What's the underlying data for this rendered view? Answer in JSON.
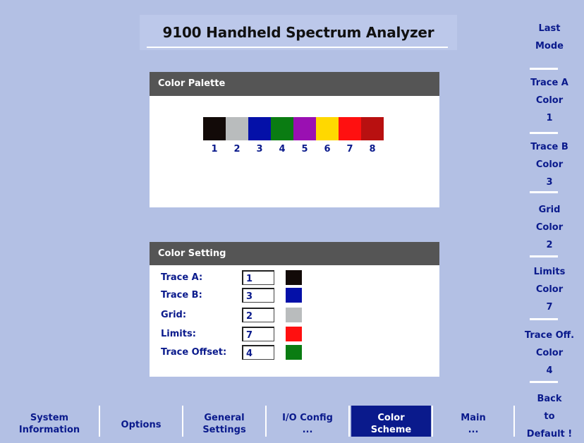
{
  "title": "9100 Handheld Spectrum Analyzer",
  "palette": {
    "header": "Color Palette",
    "swatches": [
      {
        "number": "1",
        "color": "#120a08"
      },
      {
        "number": "2",
        "color": "#b9bcbd"
      },
      {
        "number": "3",
        "color": "#0410a8"
      },
      {
        "number": "4",
        "color": "#0a7c12"
      },
      {
        "number": "5",
        "color": "#9a10b2"
      },
      {
        "number": "6",
        "color": "#ffd800"
      },
      {
        "number": "7",
        "color": "#ff1010"
      },
      {
        "number": "8",
        "color": "#b81010"
      }
    ]
  },
  "setting": {
    "header": "Color Setting",
    "rows": [
      {
        "label": "Trace A:",
        "value": "1",
        "color": "#120a08"
      },
      {
        "label": "Trace B:",
        "value": "3",
        "color": "#0410a8"
      },
      {
        "label": "Grid:",
        "value": "2",
        "color": "#b9bcbd"
      },
      {
        "label": "Limits:",
        "value": "7",
        "color": "#ff1010"
      },
      {
        "label": "Trace Offset:",
        "value": "4",
        "color": "#0a7c12"
      }
    ]
  },
  "softkeys": [
    {
      "lines": [
        "Last",
        "Mode"
      ]
    },
    {
      "lines": [
        "Trace A",
        "Color",
        "1"
      ]
    },
    {
      "lines": [
        "Trace B",
        "Color",
        "3"
      ]
    },
    {
      "lines": [
        "Grid",
        "Color",
        "2"
      ]
    },
    {
      "lines": [
        "Limits",
        "Color",
        "7"
      ]
    },
    {
      "lines": [
        "Trace Off.",
        "Color",
        "4"
      ]
    },
    {
      "lines": [
        "Back",
        "to",
        "Default !"
      ]
    }
  ],
  "bottom_keys": [
    {
      "lines": [
        "System",
        "Information"
      ],
      "active": false
    },
    {
      "lines": [
        "Options"
      ],
      "active": false
    },
    {
      "lines": [
        "General",
        "Settings"
      ],
      "active": false
    },
    {
      "lines": [
        "I/O Config",
        "..."
      ],
      "active": false
    },
    {
      "lines": [
        "Color",
        "Scheme"
      ],
      "active": true
    },
    {
      "lines": [
        "Main",
        "..."
      ],
      "active": false
    }
  ],
  "colors": {
    "background": "#b3c0e4",
    "panel_header": "#555555",
    "text": "#0a1a8c",
    "active_key": "#0a1a8c"
  }
}
